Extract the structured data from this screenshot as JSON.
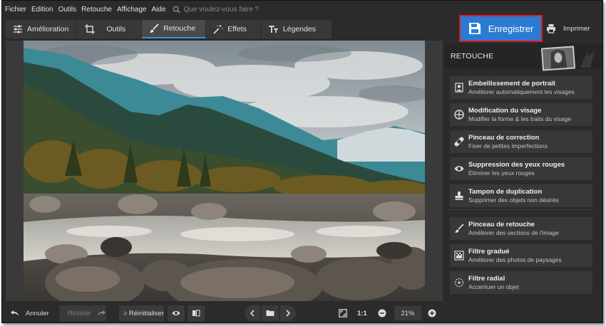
{
  "menu": [
    "Fichier",
    "Edition",
    "Outils",
    "Retouche",
    "Affichage",
    "Aide"
  ],
  "search": {
    "placeholder": "Que voulez-vous faire ?"
  },
  "tabs": [
    {
      "label": "Amélioration",
      "icon": "sliders-icon"
    },
    {
      "label": "Outils",
      "icon": "crop-icon"
    },
    {
      "label": "Retouche",
      "icon": "brush-icon",
      "active": true
    },
    {
      "label": "Effets",
      "icon": "magic-wand-icon"
    },
    {
      "label": "Légendes",
      "icon": "text-icon"
    }
  ],
  "save_button": {
    "label": "Enregistrer",
    "icon": "floppy-disk-icon",
    "color": "#2c7bd3",
    "highlight_border": "#e01b1b"
  },
  "print_button": {
    "label": "Imprimer",
    "icon": "printer-icon"
  },
  "bottom": {
    "undo": "Annuler",
    "redo": "Rétablir",
    "reset": "Réinitialiser",
    "ratio": "1:1",
    "zoom": "21%"
  },
  "panel": {
    "title": "RETOUCHE",
    "items": [
      {
        "title": "Embellissement de portrait",
        "subtitle": "Améliorer automatiquement les visages",
        "icon": "portrait-icon"
      },
      {
        "title": "Modification du visage",
        "subtitle": "Modifier la forme & les traits du visage",
        "icon": "face-icon"
      },
      {
        "title": "Pinceau de correction",
        "subtitle": "Fixer de petites imperfections",
        "icon": "bandage-icon"
      },
      {
        "title": "Suppression des yeux rouges",
        "subtitle": "Eliminer les yeux rouges",
        "icon": "eye-icon"
      },
      {
        "title": "Tampon de duplication",
        "subtitle": "Supprimer des objets non désirés",
        "icon": "stamp-icon"
      },
      {
        "title": "Pinceau de retouche",
        "subtitle": "Améliorer des sections de l'image",
        "icon": "brush-icon"
      },
      {
        "title": "Filtre gradué",
        "subtitle": "Améliorer des photos de paysages",
        "icon": "gradient-icon"
      },
      {
        "title": "Filtre radial",
        "subtitle": "Accentuer un objet",
        "icon": "radial-icon"
      }
    ]
  },
  "colors": {
    "bg": "#2b2b2b",
    "panel_item": "#383838",
    "accent": "#2c7bd3",
    "active_tab_underline": "#3a8fdc"
  }
}
